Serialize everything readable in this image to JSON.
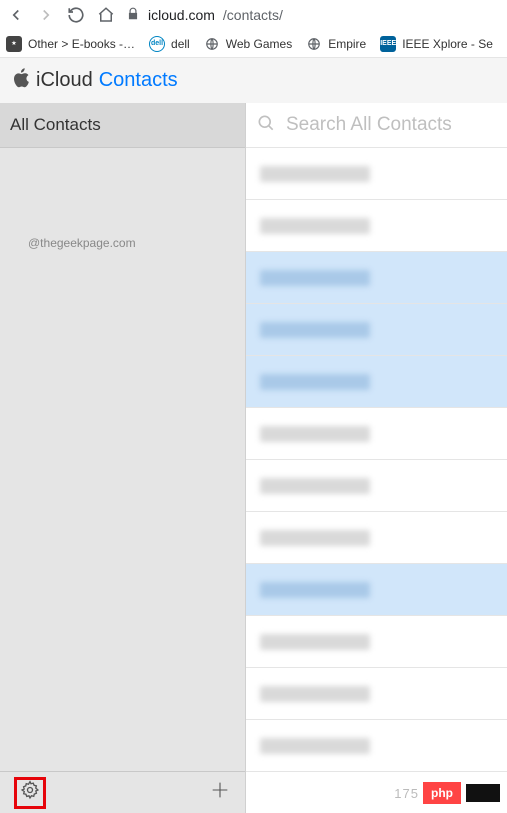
{
  "browser": {
    "url_host": "icloud.com",
    "url_path": "/contacts/"
  },
  "bookmarks": [
    {
      "label": "Other > E-books -…",
      "icon": "folder"
    },
    {
      "label": "dell",
      "icon": "dell"
    },
    {
      "label": "Web Games",
      "icon": "globe"
    },
    {
      "label": "Empire",
      "icon": "globe"
    },
    {
      "label": "IEEE Xplore - Se",
      "icon": "ieee"
    }
  ],
  "header": {
    "brand": "iCloud",
    "app": "Contacts"
  },
  "sidebar": {
    "title": "All Contacts",
    "credit": "@thegeekpage.com"
  },
  "search": {
    "placeholder": "Search All Contacts"
  },
  "contacts": [
    {
      "selected": false
    },
    {
      "selected": false
    },
    {
      "selected": true
    },
    {
      "selected": true
    },
    {
      "selected": true
    },
    {
      "selected": false
    },
    {
      "selected": false
    },
    {
      "selected": false
    },
    {
      "selected": true
    },
    {
      "selected": false
    },
    {
      "selected": false
    },
    {
      "selected": false
    }
  ],
  "footer": {
    "count_visible": "175",
    "watermark": "php"
  }
}
